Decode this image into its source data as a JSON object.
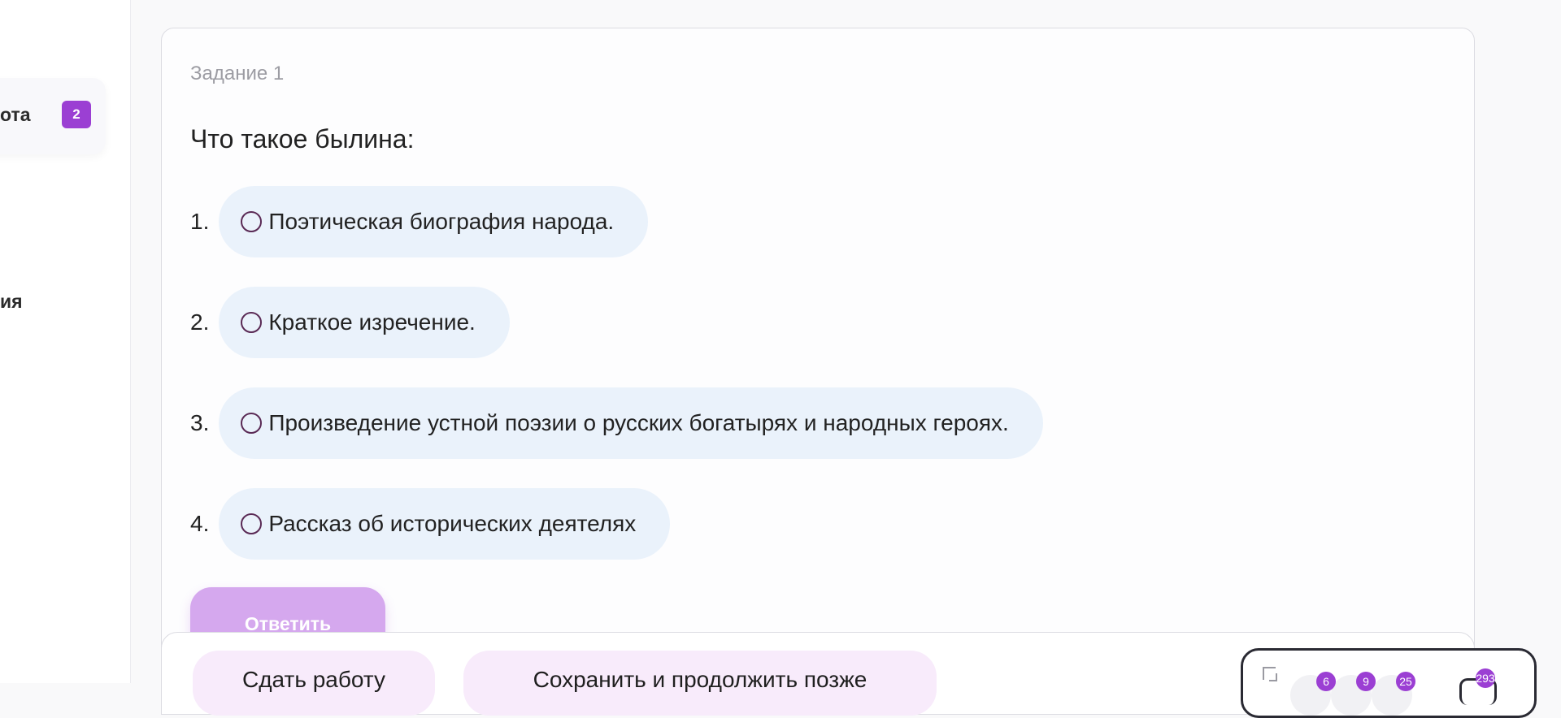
{
  "sidebar": {
    "active_item": {
      "label": "ота",
      "badge": "2"
    },
    "item_2_label": "ия"
  },
  "task": {
    "label": "Задание 1",
    "question": "Что такое былина:",
    "options": [
      {
        "number": "1.",
        "text": "Поэтическая биография народа."
      },
      {
        "number": "2.",
        "text": "Краткое изречение."
      },
      {
        "number": "3.",
        "text": "Произведение устной поэзии о русских богатырях и народных героях."
      },
      {
        "number": "4.",
        "text": "Рассказ об исторических деятелях"
      }
    ],
    "answer_button": "Ответить"
  },
  "bottom_bar": {
    "submit_button": "Сдать работу",
    "save_button": "Сохранить и продолжить позже"
  },
  "widget": {
    "counts": [
      "6",
      "9",
      "25",
      "293"
    ]
  },
  "colors": {
    "accent": "#9b3fd3",
    "option_bg": "#eaf2fb",
    "answer_button_bg": "#d5a8ee",
    "bar_button_bg": "#f8ebfb"
  },
  "icons": {
    "expand": "expand-icon",
    "radio": "radio-icon",
    "chat": "chat-icon"
  }
}
